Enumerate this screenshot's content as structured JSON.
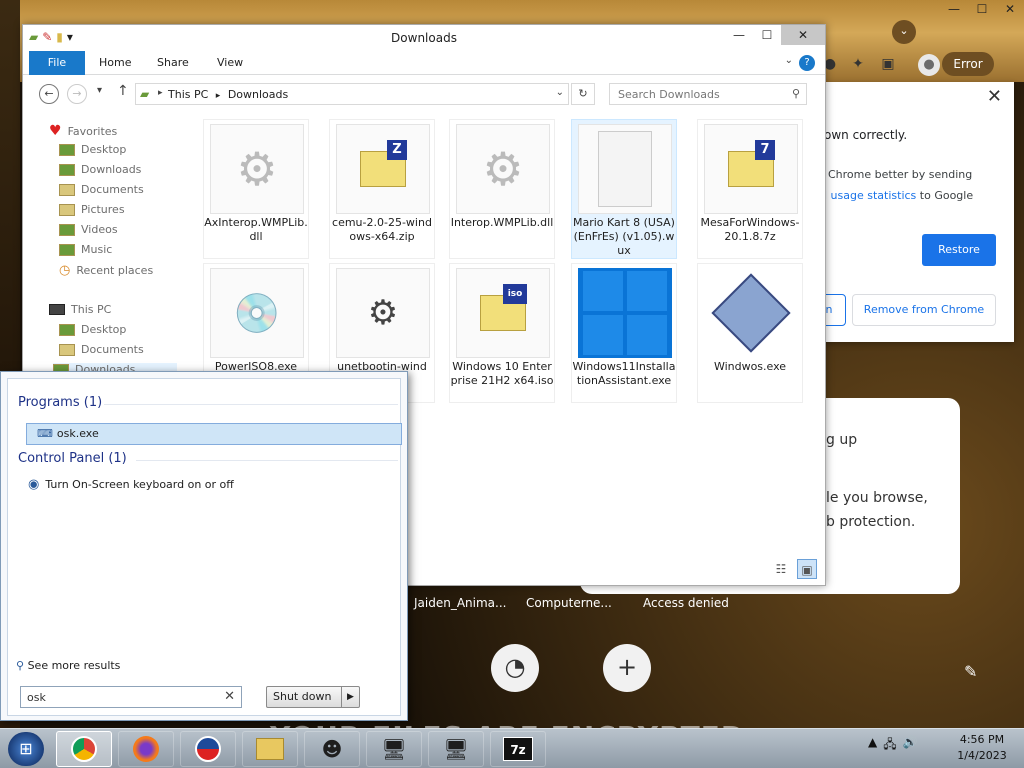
{
  "chrome": {
    "error_label": "Error",
    "popup": {
      "line1": "own correctly.",
      "line2": "Chrome better by sending",
      "line3_link": "l usage statistics",
      "line3_rest": " to Google",
      "restore": "Restore",
      "left_btn": "n",
      "remove": "Remove from Chrome"
    },
    "card": {
      "l1": "g up",
      "l2": "le you browse,",
      "l3": "b protection."
    },
    "shortcuts": [
      "Jaiden_Anima...",
      "Computerne...",
      "Access denied"
    ],
    "ransom": "YOUR FILES ARE ENCRYPTED"
  },
  "explorer": {
    "title": "Downloads",
    "ribbon_tabs": [
      "File",
      "Home",
      "Share",
      "View"
    ],
    "path": [
      "This PC",
      "Downloads"
    ],
    "search_placeholder": "Search Downloads",
    "nav": {
      "favorites": "Favorites",
      "fav_items": [
        "Desktop",
        "Downloads",
        "Documents",
        "Pictures",
        "Videos",
        "Music",
        "Recent places"
      ],
      "this_pc": "This PC",
      "pc_items": [
        "Desktop",
        "Documents",
        "Downloads"
      ]
    },
    "files": [
      {
        "name": "AxInterop.WMPLib.dll",
        "icon": "gear-icon"
      },
      {
        "name": "cemu-2.0-25-windows-x64.zip",
        "icon": "zip-icon"
      },
      {
        "name": "Interop.WMPLib.dll",
        "icon": "gear-icon"
      },
      {
        "name": "Mario Kart 8 (USA) (EnFrEs) (v1.05).wux",
        "icon": "blank-file-icon"
      },
      {
        "name": "MesaForWindows-20.1.8.7z",
        "icon": "7z-icon"
      },
      {
        "name": "PowerISO8.exe",
        "icon": "installer-icon"
      },
      {
        "name": "unetbootin-wind",
        "icon": "usb-icon"
      },
      {
        "name": "Windows 10 Enterprise 21H2 x64.iso",
        "icon": "iso-icon"
      },
      {
        "name": "Windows11InstallationAssistant.exe",
        "icon": "windows-logo-icon"
      },
      {
        "name": "Windwos.exe",
        "icon": "app-icon"
      }
    ]
  },
  "start_menu": {
    "programs_header": "Programs (1)",
    "program_item": "osk.exe",
    "cp_header": "Control Panel (1)",
    "cp_item": "Turn On-Screen keyboard on or off",
    "see_more": "See more results",
    "search_value": "osk",
    "shutdown": "Shut down"
  },
  "taskbar": {
    "time": "4:56 PM",
    "date": "1/4/2023"
  }
}
